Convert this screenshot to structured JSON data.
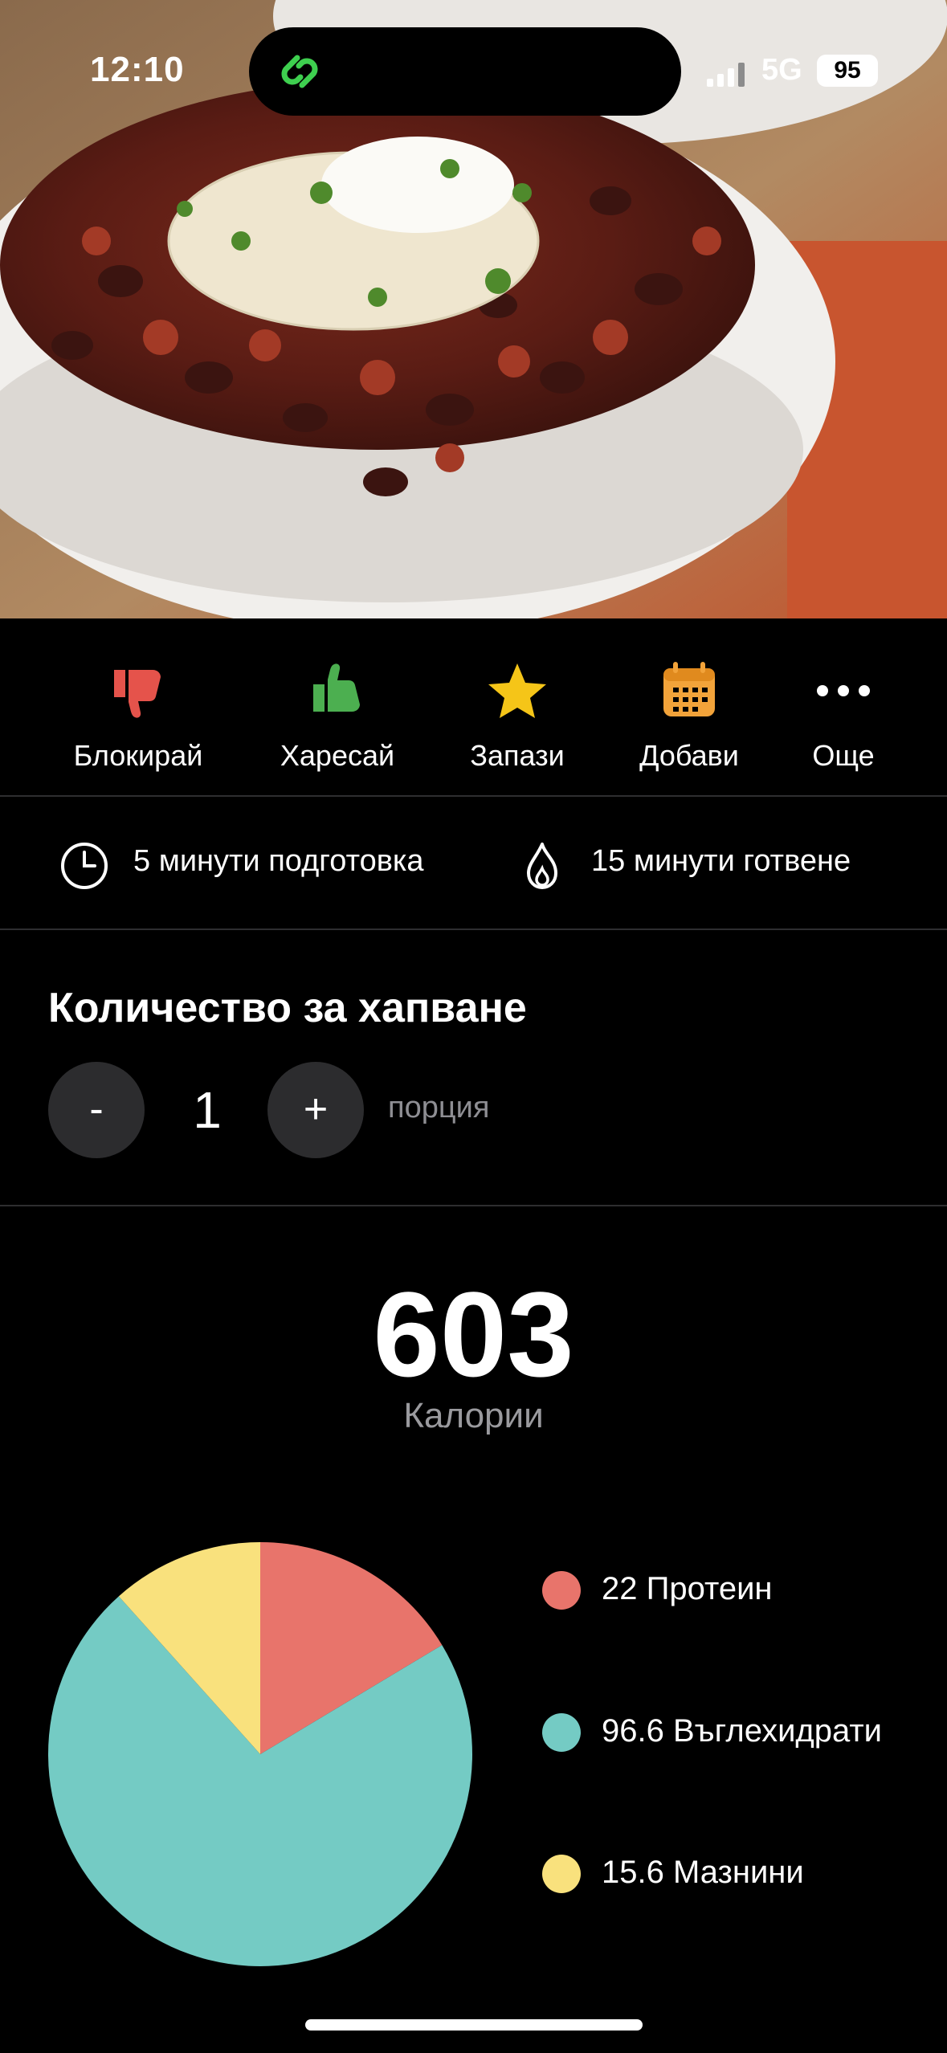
{
  "status_bar": {
    "time": "12:10",
    "network": "5G",
    "battery": "95"
  },
  "actions": [
    {
      "label": "Блокирай",
      "icon": "thumbs-down-icon",
      "color": "#e5534b"
    },
    {
      "label": "Харесай",
      "icon": "thumbs-up-icon",
      "color": "#4caf50"
    },
    {
      "label": "Запази",
      "icon": "star-icon",
      "color": "#f5c518"
    },
    {
      "label": "Добави",
      "icon": "calendar-icon",
      "color": "#f2a33a"
    },
    {
      "label": "Още",
      "icon": "more-dots-icon",
      "color": "#ffffff"
    }
  ],
  "timing": {
    "prep": "5 минути подготовка",
    "cook": "15 минути готвене"
  },
  "servings": {
    "title": "Количество за хапване",
    "minus": "-",
    "quantity": "1",
    "plus": "+",
    "unit": "порция"
  },
  "calories": {
    "value": "603",
    "label": "Калории"
  },
  "chart_data": {
    "type": "pie",
    "slices": [
      {
        "label": "22 Протеин",
        "value": 22,
        "color": "#e8746b"
      },
      {
        "label": "96.6 Въглехидрати",
        "value": 96.6,
        "color": "#74cbc4"
      },
      {
        "label": "15.6 Мазнини",
        "value": 15.6,
        "color": "#f9e17d"
      }
    ]
  }
}
